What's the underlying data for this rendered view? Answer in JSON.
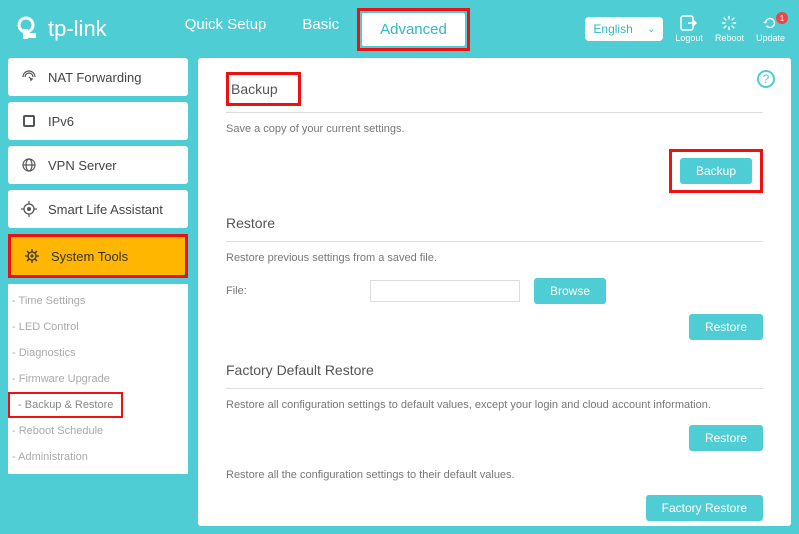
{
  "brand": "tp-link",
  "topnav": {
    "quick": "Quick Setup",
    "basic": "Basic",
    "advanced": "Advanced"
  },
  "lang": "English",
  "topicons": {
    "logout": "Logout",
    "reboot": "Reboot",
    "update": "Update",
    "update_badge": "1"
  },
  "sidebar": {
    "nat": "NAT Forwarding",
    "ipv6": "IPv6",
    "vpn": "VPN Server",
    "smart": "Smart Life Assistant",
    "system": "System Tools",
    "subs": {
      "time": "Time Settings",
      "led": "LED Control",
      "diag": "Diagnostics",
      "fw": "Firmware Upgrade",
      "backup": "Backup & Restore",
      "reboot": "Reboot Schedule",
      "admin": "Administration"
    }
  },
  "content": {
    "backup_title": "Backup",
    "backup_desc": "Save a copy of your current settings.",
    "backup_btn": "Backup",
    "restore_title": "Restore",
    "restore_desc": "Restore previous settings from a saved file.",
    "file_label": "File:",
    "browse": "Browse",
    "restore_btn": "Restore",
    "factory_title": "Factory Default Restore",
    "factory_desc1": "Restore all configuration settings to default values, except your login and cloud account information.",
    "factory_restore_btn": "Restore",
    "factory_desc2": "Restore all the configuration settings to their default values.",
    "factory_reset_btn": "Factory Restore"
  }
}
